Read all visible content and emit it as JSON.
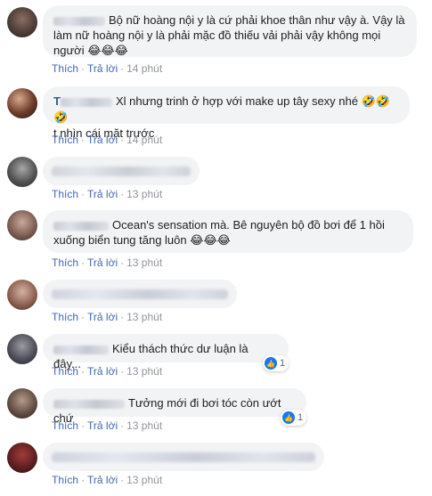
{
  "comments": [
    {
      "text": "Bộ nữ hoàng nội y là cứ phải khoe thân như vậy à. Vậy là làm nữ hoàng nội y là phải mặc đồ thiếu vải phải vậy không mọi người",
      "emoji": "😂😂😂",
      "like": "Thích",
      "reply": "Trả lời",
      "time": "14 phút"
    },
    {
      "name_visible": "T",
      "text": "Xl nhưng trinh ở hợp với make up tây sexy nhé",
      "text2": "t nhìn cái mặt trước",
      "emoji": "🤣🤣🤣",
      "like": "Thích",
      "reply": "Trả lời",
      "time": "14 phút"
    },
    {
      "like": "Thích",
      "reply": "Trả lời",
      "time": "13 phút"
    },
    {
      "text": "Ocean's sensation mà. Bê nguyên bộ đồ bơi để 1 hồi xuống biển tung tăng luôn",
      "emoji": "😂😂😂",
      "like": "Thích",
      "reply": "Trả lời",
      "time": "13 phút"
    },
    {
      "like": "Thích",
      "reply": "Trả lời",
      "time": "13 phút"
    },
    {
      "text": "Kiểu thách thức dư luận là đây...",
      "reaction_count": "1",
      "like": "Thích",
      "reply": "Trả lời",
      "time": "13 phút"
    },
    {
      "text": "Tưởng mới đi bơi tóc còn ướt chứ",
      "reaction_count": "1",
      "like": "Thích",
      "reply": "Trả lời",
      "time": "13 phút"
    },
    {
      "like": "Thích",
      "reply": "Trả lời",
      "time": "13 phút"
    }
  ],
  "colors": {
    "bubble": "#f2f3f5",
    "link": "#4267b2",
    "meta": "#90949c",
    "like_reaction": "#1877f2"
  },
  "icons": [
    "like-reaction-icon",
    "avatar"
  ]
}
